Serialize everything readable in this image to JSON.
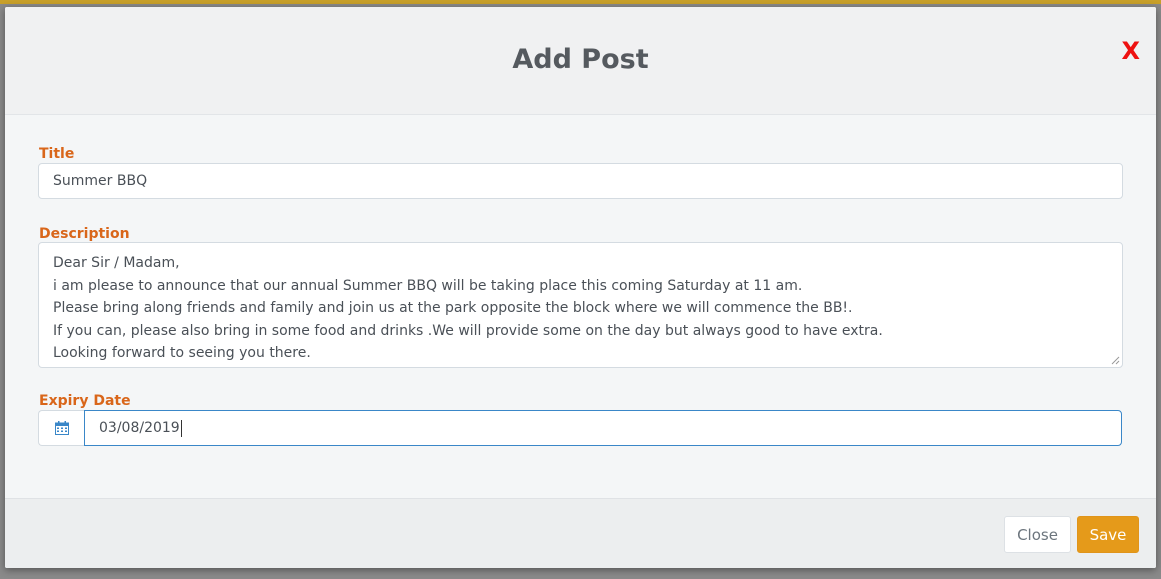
{
  "modal": {
    "title": "Add Post",
    "close_icon_glyph": "X",
    "accent_color": "#d9661a",
    "close_color": "#ee1111"
  },
  "form": {
    "title_label": "Title",
    "title_value": "Summer BBQ",
    "description_label": "Description",
    "description_lines": [
      "Dear Sir / Madam,",
      "i am please to announce that our annual Summer BBQ will be taking place this coming Saturday at 11 am.",
      "Please bring along friends and family and join us at the park opposite the block where we will commence the BB!.",
      "If you can, please also bring in some food and drinks .We will provide some on the day but always good to have extra.",
      "Looking forward to seeing you there."
    ],
    "expiry_label": "Expiry Date",
    "expiry_value": "03/08/2019",
    "calendar_icon": "calendar-icon"
  },
  "footer": {
    "close_label": "Close",
    "save_label": "Save",
    "save_color": "#e59a1a"
  }
}
